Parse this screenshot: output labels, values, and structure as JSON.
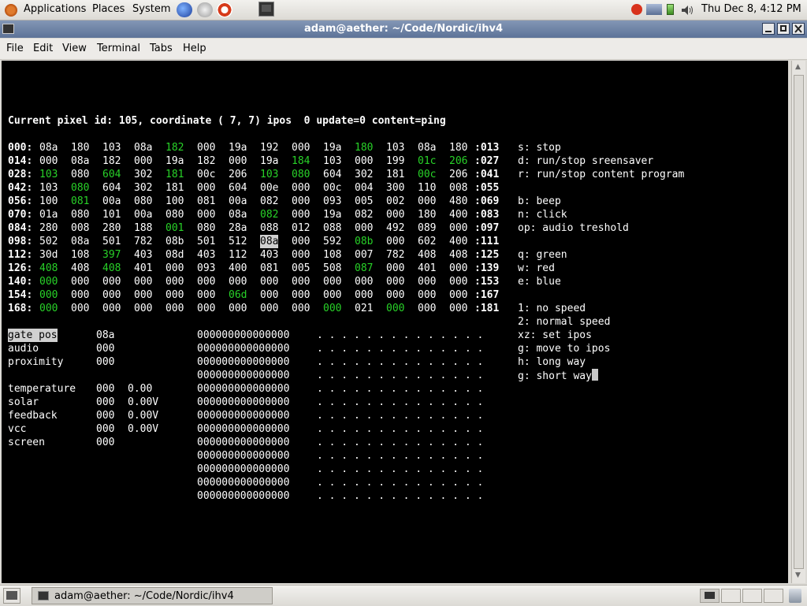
{
  "top_panel": {
    "applications": "Applications",
    "places": "Places",
    "system": "System",
    "clock": "Thu Dec  8,  4:12 PM"
  },
  "window": {
    "title": "adam@aether: ~/Code/Nordic/ihv4"
  },
  "menu": [
    "File",
    "Edit",
    "View",
    "Terminal",
    "Tabs",
    "Help"
  ],
  "terminal": {
    "status_line": "Current pixel id: 105, coordinate ( 7, 7) ipos  0 update=0 content=ping",
    "rows": [
      {
        "start": "000:",
        "end": ":013",
        "cells": [
          "08a",
          "180",
          "103",
          "08a",
          "182",
          "000",
          "19a",
          "192",
          "000",
          "19a",
          "180",
          "103",
          "08a",
          "180"
        ],
        "green": [
          4,
          10
        ],
        "highlight": []
      },
      {
        "start": "014:",
        "end": ":027",
        "cells": [
          "000",
          "08a",
          "182",
          "000",
          "19a",
          "182",
          "000",
          "19a",
          "184",
          "103",
          "000",
          "199",
          "01c",
          "206"
        ],
        "green": [
          8,
          12,
          13
        ],
        "highlight": []
      },
      {
        "start": "028:",
        "end": ":041",
        "cells": [
          "103",
          "080",
          "604",
          "302",
          "181",
          "00c",
          "206",
          "103",
          "080",
          "604",
          "302",
          "181",
          "00c",
          "206"
        ],
        "green": [
          0,
          2,
          4,
          7,
          8,
          12
        ],
        "highlight": []
      },
      {
        "start": "042:",
        "end": ":055",
        "cells": [
          "103",
          "080",
          "604",
          "302",
          "181",
          "000",
          "604",
          "00e",
          "000",
          "00c",
          "004",
          "300",
          "110",
          "008"
        ],
        "green": [
          1
        ],
        "highlight": []
      },
      {
        "start": "056:",
        "end": ":069",
        "cells": [
          "100",
          "081",
          "00a",
          "080",
          "100",
          "081",
          "00a",
          "082",
          "000",
          "093",
          "005",
          "002",
          "000",
          "480"
        ],
        "green": [
          1
        ],
        "highlight": []
      },
      {
        "start": "070:",
        "end": ":083",
        "cells": [
          "01a",
          "080",
          "101",
          "00a",
          "080",
          "000",
          "08a",
          "082",
          "000",
          "19a",
          "082",
          "000",
          "180",
          "400"
        ],
        "green": [
          7
        ],
        "highlight": []
      },
      {
        "start": "084:",
        "end": ":097",
        "cells": [
          "280",
          "008",
          "280",
          "188",
          "001",
          "080",
          "28a",
          "088",
          "012",
          "088",
          "000",
          "492",
          "089",
          "000"
        ],
        "green": [
          4
        ],
        "highlight": []
      },
      {
        "start": "098:",
        "end": ":111",
        "cells": [
          "502",
          "08a",
          "501",
          "782",
          "08b",
          "501",
          "512",
          "08a",
          "000",
          "592",
          "08b",
          "000",
          "602",
          "400"
        ],
        "green": [
          10
        ],
        "highlight": [
          7
        ]
      },
      {
        "start": "112:",
        "end": ":125",
        "cells": [
          "30d",
          "108",
          "397",
          "403",
          "08d",
          "403",
          "112",
          "403",
          "000",
          "108",
          "007",
          "782",
          "408",
          "408"
        ],
        "green": [
          2
        ],
        "highlight": []
      },
      {
        "start": "126:",
        "end": ":139",
        "cells": [
          "408",
          "408",
          "408",
          "401",
          "000",
          "093",
          "400",
          "081",
          "005",
          "508",
          "087",
          "000",
          "401",
          "000"
        ],
        "green": [
          0,
          2,
          10
        ],
        "highlight": []
      },
      {
        "start": "140:",
        "end": ":153",
        "cells": [
          "000",
          "000",
          "000",
          "000",
          "000",
          "000",
          "000",
          "000",
          "000",
          "000",
          "000",
          "000",
          "000",
          "000"
        ],
        "green": [
          0
        ],
        "highlight": []
      },
      {
        "start": "154:",
        "end": ":167",
        "cells": [
          "000",
          "000",
          "000",
          "000",
          "000",
          "000",
          "06d",
          "000",
          "000",
          "000",
          "000",
          "000",
          "000",
          "000"
        ],
        "green": [
          0,
          6
        ],
        "highlight": []
      },
      {
        "start": "168:",
        "end": ":181",
        "cells": [
          "000",
          "000",
          "000",
          "000",
          "000",
          "000",
          "000",
          "000",
          "000",
          "000",
          "021",
          "000",
          "000",
          "000"
        ],
        "green": [
          0,
          9,
          11
        ],
        "highlight": []
      }
    ],
    "help": [
      {
        "text": "s: stop",
        "row": 0
      },
      {
        "text": "d: run/stop sreensaver",
        "row": 1
      },
      {
        "text": "r: run/stop content program",
        "row": 2
      },
      {
        "text": "b: beep",
        "row": 4
      },
      {
        "text": "n: click",
        "row": 5
      },
      {
        "text": "op: audio treshold",
        "row": 6
      },
      {
        "text": "q: green",
        "row": 8
      },
      {
        "text": "w: red",
        "row": 9
      },
      {
        "text": "e: blue",
        "row": 10
      },
      {
        "text": "1: no speed",
        "row": 12
      },
      {
        "text": "2: normal speed",
        "row": 13
      },
      {
        "text": "xz: set ipos",
        "row": 14
      },
      {
        "text": "g: move to ipos",
        "row": 15
      },
      {
        "text": "h: long way",
        "row": 16
      },
      {
        "text": "g: short way",
        "row": 17
      }
    ],
    "sensors": [
      {
        "label": "gate pos",
        "value": "08a",
        "extra": "",
        "row": 0,
        "highlight": true
      },
      {
        "label": "audio",
        "value": "000",
        "extra": "",
        "row": 1,
        "highlight": false
      },
      {
        "label": "proximity",
        "value": "000",
        "extra": "",
        "row": 2,
        "highlight": false
      },
      {
        "label": "temperature",
        "value": "000",
        "extra": "0.00",
        "row": 4,
        "highlight": false
      },
      {
        "label": "solar",
        "value": "000",
        "extra": "0.00V",
        "row": 5,
        "highlight": false
      },
      {
        "label": "feedback",
        "value": "000",
        "extra": "0.00V",
        "row": 6,
        "highlight": false
      },
      {
        "label": "vcc",
        "value": "000",
        "extra": "0.00V",
        "row": 7,
        "highlight": false
      },
      {
        "label": "screen",
        "value": "000",
        "extra": "",
        "row": 8,
        "highlight": false
      }
    ],
    "bits": [
      "000000000000000",
      "000000000000000",
      "000000000000000",
      "000000000000000",
      "000000000000000",
      "000000000000000",
      "000000000000000",
      "000000000000000",
      "000000000000000",
      "000000000000000",
      "000000000000000",
      "000000000000000",
      "000000000000000"
    ],
    "dots": [
      ". . . . . . . . . . . . . .",
      ". . . . . . . . . . . . . .",
      ". . . . . . . . . . . . . .",
      ". . . . . . . . . . . . . .",
      ". . . . . . . . . . . . . .",
      ". . . . . . . . . . . . . .",
      ". . . . . . . . . . . . . .",
      ". . . . . . . . . . . . . .",
      ". . . . . . . . . . . . . .",
      ". . . . . . . . . . . . . .",
      ". . . . . . . . . . . . . .",
      ". . . . . . . . . . . . . .",
      ". . . . . . . . . . . . . ."
    ]
  },
  "taskbar": {
    "task_label": "adam@aether: ~/Code/Nordic/ihv4"
  },
  "colors": {
    "terminal_bg": "#000000",
    "terminal_fg": "#ffffff",
    "green": "#28d228",
    "titlebar": "#6f83a8"
  },
  "icons": {
    "top_panel": [
      "ubuntu-logo-icon",
      "web-browser-icon",
      "mail-icon",
      "help-icon",
      "terminal-launcher-icon"
    ],
    "tray": [
      "update-icon",
      "network-icon",
      "battery-icon",
      "volume-icon"
    ]
  }
}
